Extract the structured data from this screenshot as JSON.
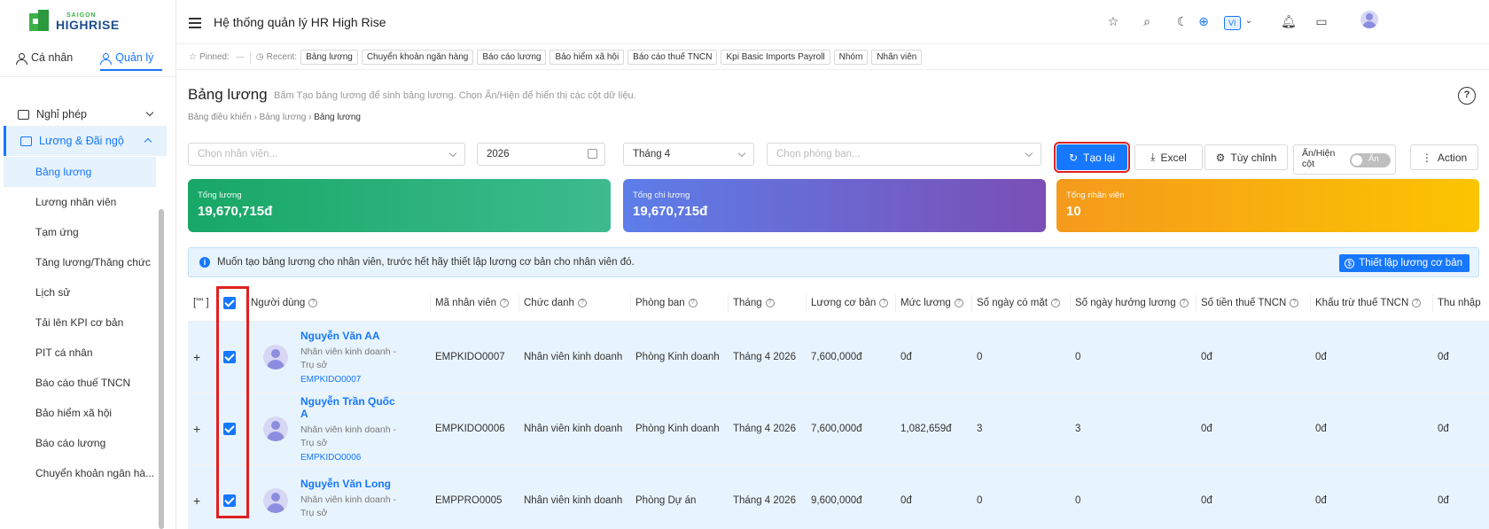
{
  "brand": {
    "line1": "SAIGON",
    "line2": "HIGHRISE"
  },
  "sidebar": {
    "tabs": [
      {
        "label": "Cá nhân",
        "active": false
      },
      {
        "label": "Quản lý",
        "active": true
      }
    ],
    "groups": [
      {
        "label": "Nghỉ phép",
        "expanded": false
      },
      {
        "label": "Lương & Đãi ngộ",
        "expanded": true
      }
    ],
    "items": [
      {
        "label": "Bảng lương",
        "active": true
      },
      {
        "label": "Lương nhân viên"
      },
      {
        "label": "Tạm ứng"
      },
      {
        "label": "Tăng lương/Thăng chức"
      },
      {
        "label": "Lịch sử"
      },
      {
        "label": "Tải lên KPI cơ bản"
      },
      {
        "label": "PIT cá nhân"
      },
      {
        "label": "Báo cáo thuế TNCN"
      },
      {
        "label": "Bảo hiểm xã hội"
      },
      {
        "label": "Báo cáo lương"
      },
      {
        "label": "Chuyển khoản ngân hà..."
      }
    ]
  },
  "header": {
    "title": "Hệ thống quản lý HR High Rise",
    "lang": "VI",
    "icons": [
      "star-icon",
      "search-icon",
      "moon-icon",
      "plus-circle-icon",
      "bell-icon",
      "calendar-icon",
      "avatar"
    ]
  },
  "pinbar": {
    "pinned_label": "Pinned:",
    "pinned_value": "—",
    "recent_label": "Recent:",
    "recent": [
      "Bảng lương",
      "Chuyển khoản ngân hàng",
      "Báo cáo lương",
      "Bảo hiểm xã hội",
      "Báo cáo thuế TNCN",
      "Kpi Basic Imports Payroll",
      "Nhóm",
      "Nhân viên"
    ]
  },
  "page": {
    "title": "Bảng lương",
    "description": "Bấm Tạo bảng lương để sinh bảng lương. Chọn Ẩn/Hiện để hiển thị các cột dữ liệu.",
    "breadcrumb": [
      "Bảng điều khiển",
      "Bảng lương",
      "Bảng lương"
    ]
  },
  "filters": {
    "employee_placeholder": "Chọn nhân viên...",
    "year": "2026",
    "month": "Tháng 4",
    "department_placeholder": "Chọn phòng ban..."
  },
  "actions": {
    "regenerate": "Tạo lại",
    "excel": "Excel",
    "customize": "Tùy chỉnh",
    "toggle_label": "Ẩn/Hiện cột",
    "toggle_state": "Ẩn",
    "action": "Action"
  },
  "stats": [
    {
      "label": "Tổng lương",
      "value": "19,670,715đ"
    },
    {
      "label": "Tổng chi lương",
      "value": "19,670,715đ"
    },
    {
      "label": "Tổng nhân viên",
      "value": "10"
    }
  ],
  "alert": {
    "text": "Muốn tạo bảng lương cho nhân viên, trước hết hãy thiết lập lương cơ bản cho nhân viên đó.",
    "button": "Thiết lập lương cơ bản"
  },
  "table": {
    "expand_header": "[\"\" ]",
    "columns": [
      "Người dùng",
      "Mã nhân viên",
      "Chức danh",
      "Phòng ban",
      "Tháng",
      "Lương cơ bản",
      "Mức lương",
      "Số ngày có mặt",
      "Số ngày hưởng lương",
      "Số tiền thuế TNCN",
      "Khấu trừ thuế TNCN",
      "Thu nhập"
    ],
    "rows": [
      {
        "name": "Nguyễn Văn AA",
        "role": "Nhân viên kinh doanh - Trụ sở",
        "code": "EMPKIDO0007",
        "emp_id": "EMPKIDO0007",
        "title": "Nhân viên kinh doanh",
        "dept": "Phòng Kinh doanh",
        "month": "Tháng 4 2026",
        "base": "7,600,000đ",
        "rate": "0đ",
        "present": "0",
        "paid_days": "0",
        "tax": "0đ",
        "tax_deduct": "0đ",
        "income": "0đ"
      },
      {
        "name": "Nguyễn Trần Quốc A",
        "role": "Nhân viên kinh doanh - Trụ sở",
        "code": "EMPKIDO0006",
        "emp_id": "EMPKIDO0006",
        "title": "Nhân viên kinh doanh",
        "dept": "Phòng Kinh doanh",
        "month": "Tháng 4 2026",
        "base": "7,600,000đ",
        "rate": "1,082,659đ",
        "present": "3",
        "paid_days": "3",
        "tax": "0đ",
        "tax_deduct": "0đ",
        "income": "0đ"
      },
      {
        "name": "Nguyễn Văn Long",
        "role": "Nhân viên kinh doanh - Trụ sở",
        "code": "",
        "emp_id": "EMPPRO0005",
        "title": "Nhân viên kinh doanh",
        "dept": "Phòng Dự án",
        "month": "Tháng 4 2026",
        "base": "9,600,000đ",
        "rate": "0đ",
        "present": "0",
        "paid_days": "0",
        "tax": "0đ",
        "tax_deduct": "0đ",
        "income": "0đ"
      }
    ]
  },
  "colors": {
    "primary": "#1677ff",
    "highlight": "#e02020",
    "row_selected": "#e8f4fd"
  }
}
